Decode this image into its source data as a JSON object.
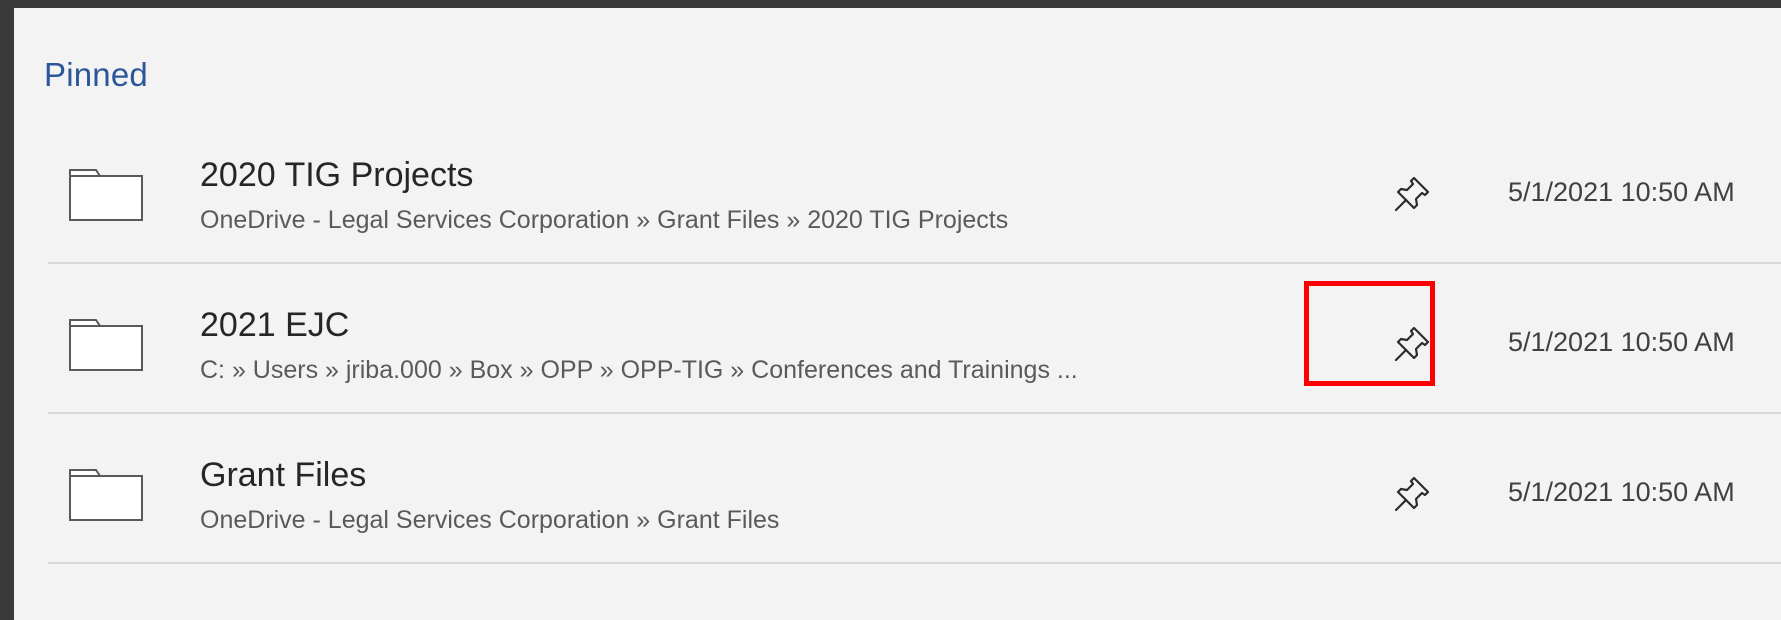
{
  "section": {
    "title": "Pinned"
  },
  "items": [
    {
      "name": "2020 TIG Projects",
      "path": "OneDrive - Legal Services Corporation » Grant Files » 2020 TIG Projects",
      "date": "5/1/2021 10:50 AM",
      "icon": "folder-icon",
      "pin_icon": "pin-icon"
    },
    {
      "name": "2021 EJC",
      "path": "C: » Users » jriba.000 » Box » OPP » OPP-TIG » Conferences and Trainings ...",
      "date": "5/1/2021 10:50 AM",
      "icon": "folder-icon",
      "pin_icon": "pin-icon",
      "highlighted": true
    },
    {
      "name": "Grant Files",
      "path": "OneDrive - Legal Services Corporation » Grant Files",
      "date": "5/1/2021 10:50 AM",
      "icon": "folder-icon",
      "pin_icon": "pin-icon"
    }
  ],
  "colors": {
    "section_title": "#2b579a",
    "highlight": "#ff0000",
    "background": "#f3f3f3",
    "frame": "#3a3a3a"
  }
}
